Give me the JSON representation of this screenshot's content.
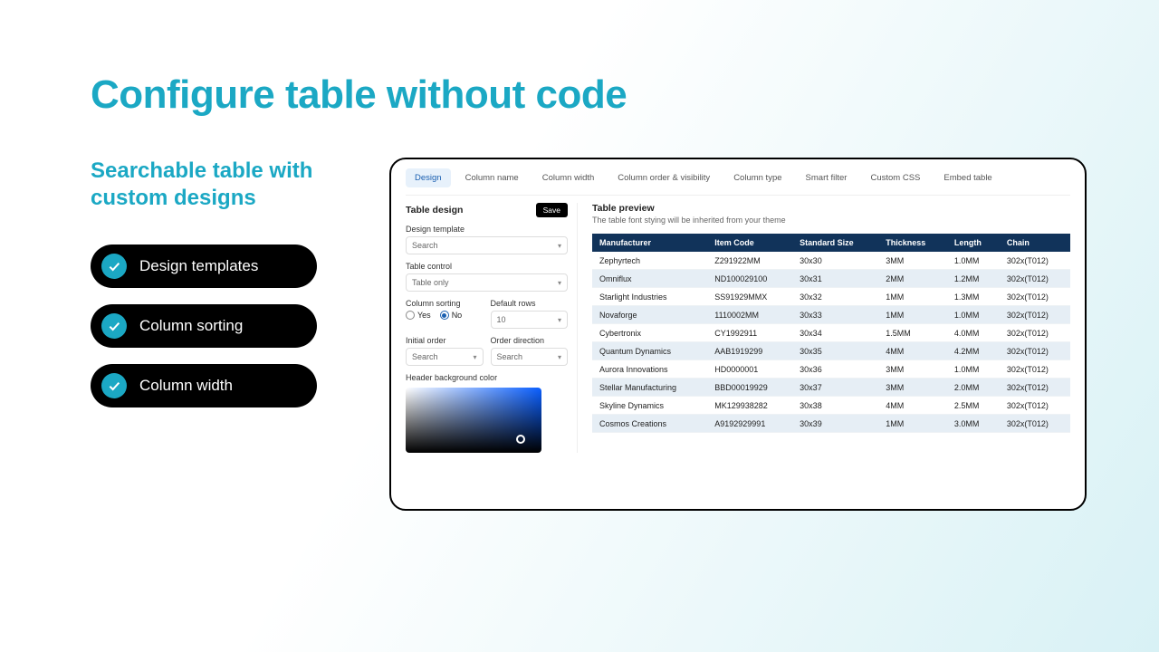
{
  "headline": "Configure table without code",
  "subhead": "Searchable table with custom designs",
  "features": [
    "Design templates",
    "Column sorting",
    "Column width"
  ],
  "panel": {
    "tabs": [
      "Design",
      "Column name",
      "Column width",
      "Column order & visibility",
      "Column type",
      "Smart filter",
      "Custom CSS",
      "Embed table"
    ],
    "active_tab": 0,
    "sidebar": {
      "title": "Table design",
      "save": "Save",
      "design_template_label": "Design template",
      "design_template_value": "Search",
      "table_control_label": "Table control",
      "table_control_value": "Table only",
      "column_sorting_label": "Column sorting",
      "column_sorting_options": {
        "yes": "Yes",
        "no": "No"
      },
      "column_sorting_selected": "no",
      "default_rows_label": "Default rows",
      "default_rows_value": "10",
      "initial_order_label": "Initial order",
      "initial_order_value": "Search",
      "order_direction_label": "Order direction",
      "order_direction_value": "Search",
      "header_bg_label": "Header background color"
    },
    "preview": {
      "title": "Table preview",
      "subtitle": "The table font stying will be inherited from your theme",
      "columns": [
        "Manufacturer",
        "Item Code",
        "Standard Size",
        "Thickness",
        "Length",
        "Chain"
      ],
      "rows": [
        [
          "Zephyrtech",
          "Z291922MM",
          "30x30",
          "3MM",
          "1.0MM",
          "302x(T012)"
        ],
        [
          "Omniflux",
          "ND100029100",
          "30x31",
          "2MM",
          "1.2MM",
          "302x(T012)"
        ],
        [
          "Starlight Industries",
          "SS91929MMX",
          "30x32",
          "1MM",
          "1.3MM",
          "302x(T012)"
        ],
        [
          "Novaforge",
          "1110002MM",
          "30x33",
          "1MM",
          "1.0MM",
          "302x(T012)"
        ],
        [
          "Cybertronix",
          "CY1992911",
          "30x34",
          "1.5MM",
          "4.0MM",
          "302x(T012)"
        ],
        [
          "Quantum Dynamics",
          "AAB1919299",
          "30x35",
          "4MM",
          "4.2MM",
          "302x(T012)"
        ],
        [
          "Aurora Innovations",
          "HD0000001",
          "30x36",
          "3MM",
          "1.0MM",
          "302x(T012)"
        ],
        [
          "Stellar Manufacturing",
          "BBD00019929",
          "30x37",
          "3MM",
          "2.0MM",
          "302x(T012)"
        ],
        [
          "Skyline Dynamics",
          "MK129938282",
          "30x38",
          "4MM",
          "2.5MM",
          "302x(T012)"
        ],
        [
          "Cosmos Creations",
          "A9192929991",
          "30x39",
          "1MM",
          "3.0MM",
          "302x(T012)"
        ]
      ]
    }
  }
}
